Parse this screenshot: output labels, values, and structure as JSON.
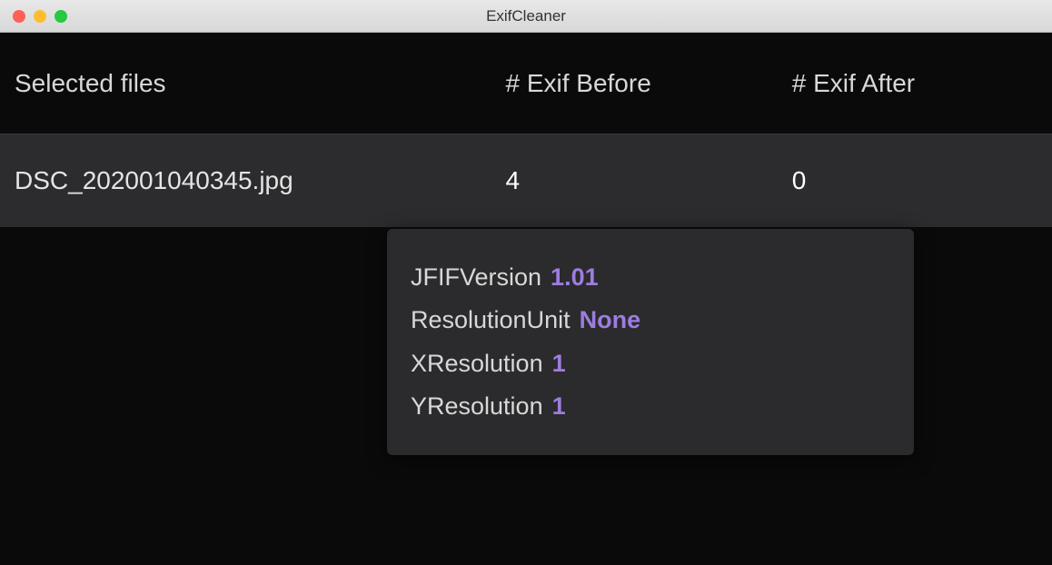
{
  "window": {
    "title": "ExifCleaner"
  },
  "table": {
    "headers": {
      "file": "Selected files",
      "before": "# Exif Before",
      "after": "# Exif After"
    },
    "row": {
      "filename": "DSC_202001040345.jpg",
      "before": "4",
      "after": "0"
    }
  },
  "tooltip": {
    "items": [
      {
        "key": "JFIFVersion",
        "value": "1.01"
      },
      {
        "key": "ResolutionUnit",
        "value": "None"
      },
      {
        "key": "XResolution",
        "value": "1"
      },
      {
        "key": "YResolution",
        "value": "1"
      }
    ]
  }
}
